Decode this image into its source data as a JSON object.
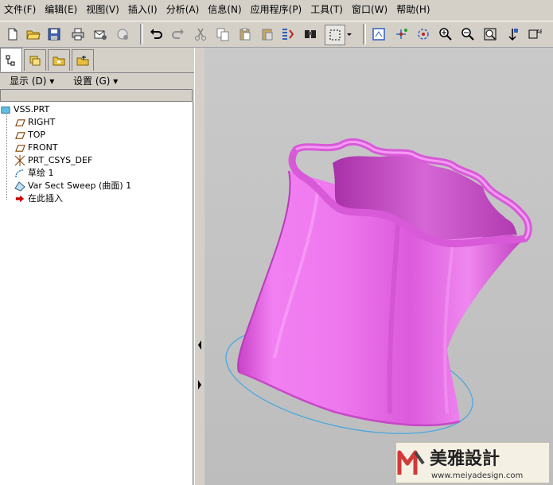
{
  "menu": [
    "文件(F)",
    "编辑(E)",
    "视图(V)",
    "插入(I)",
    "分析(A)",
    "信息(N)",
    "应用程序(P)",
    "工具(T)",
    "窗口(W)",
    "帮助(H)"
  ],
  "left_panel": {
    "show_label": "显示 (D) ▾",
    "settings_label": "设置 (G) ▾"
  },
  "tree": {
    "root": "VSS.PRT",
    "items": [
      "RIGHT",
      "TOP",
      "FRONT",
      "PRT_CSYS_DEF",
      "草绘 1",
      "Var Sect Sweep (曲面) 1",
      "在此插入"
    ]
  },
  "watermark": {
    "brand": "美雅設計",
    "url": "www.meiyadesign.com"
  },
  "colors": {
    "model": "#ee7cee",
    "model_shade": "#b43cb4",
    "sketch": "#4aa8e0",
    "insert_arrow": "#cc0000"
  }
}
